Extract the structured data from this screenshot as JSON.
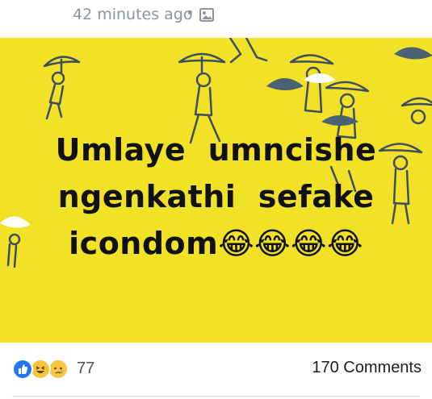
{
  "post": {
    "timestamp": "42 minutes ago",
    "separator": "•",
    "privacy_icon": "photo-icon",
    "caption_lines": [
      "Umlaye  umncishe",
      "ngenkathi  sefake",
      "icondom😂😂😂😂"
    ],
    "colors": {
      "image_bg": "#f1e228",
      "figure_line": "#3d4f5f",
      "umbrella_dark": "#4a6272"
    }
  },
  "footer": {
    "reactions": [
      "like-icon",
      "haha-icon",
      "sad-icon"
    ],
    "reaction_count": "77",
    "comments": "170 Comments"
  }
}
